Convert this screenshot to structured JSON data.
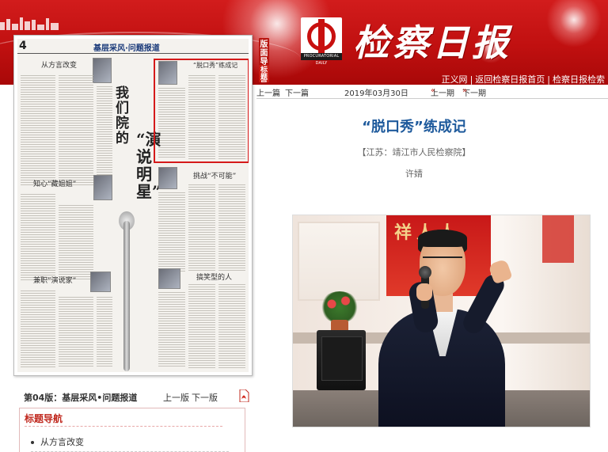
{
  "header": {
    "logo_title": "检察日报",
    "logo_emblem_caption": "PROCURATORIAL DAILY",
    "links": [
      "正义网",
      "返回检察日报首页",
      "检察日报检索"
    ]
  },
  "side_tabs": {
    "layout": "版面导航",
    "title_nav": "标题导航"
  },
  "newspaper": {
    "page_number": "4",
    "section_header": "基层采风·问题报道",
    "headlines": [
      "从方言改变",
      "“脱口秀”练成记",
      "知心“藏姐姐”",
      "挑战“不可能”",
      "兼职“演说家”",
      "搞笑型的人"
    ],
    "feature_caption_1": "我们院的",
    "feature_caption_2": "“演说明星”"
  },
  "section": {
    "name": "第04版：基层采风•问题报道",
    "prev": "上一版",
    "next": "下一版",
    "pdf_icon": "pdf-icon"
  },
  "title_nav": {
    "title": "标题导航",
    "items": [
      "从方言改变"
    ]
  },
  "article_nav": {
    "prev_article": "上一篇",
    "next_article": "下一篇",
    "date": "2019年03月30日",
    "prev_issue": "上一期",
    "next_issue": "下一期"
  },
  "article": {
    "title": "“脱口秀”练成记",
    "source": "【江苏：靖江市人民检察院】",
    "author": "许婧"
  },
  "photo": {
    "banner_text": "祥人人"
  },
  "colors": {
    "brand_red": "#c8100f",
    "title_blue": "#1e5a9c",
    "nav_red": "#c0281e"
  }
}
